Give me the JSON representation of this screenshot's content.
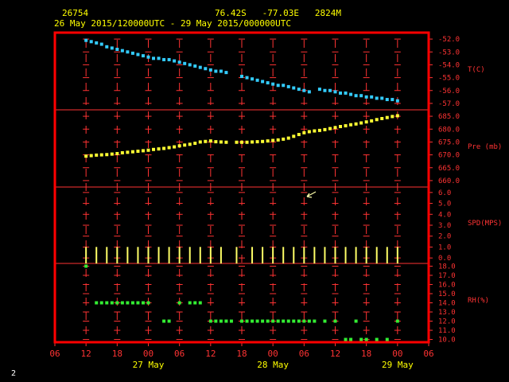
{
  "header": {
    "station": "26754",
    "location": "76.42S   -77.03E   2824M",
    "date_range": "26 May 2015/120000UTC - 29 May 2015/000000UTC"
  },
  "corner_label": "2",
  "chart_data": [
    {
      "type": "scatter",
      "title": "",
      "ylabel": "T(C)",
      "ylim": [
        -57.5,
        -51.5
      ],
      "yticks": [
        -52.0,
        -53.0,
        -54.0,
        -55.0,
        -56.0,
        -57.0
      ],
      "color": "#33ccff",
      "x_hours": [
        12,
        13,
        14,
        15,
        16,
        17,
        18,
        19,
        20,
        21,
        22,
        23,
        24,
        25,
        26,
        27,
        28,
        29,
        30,
        31,
        32,
        33,
        34,
        35,
        36,
        37,
        38,
        39,
        42,
        43,
        44,
        45,
        46,
        47,
        48,
        49,
        50,
        51,
        52,
        53,
        54,
        55,
        57,
        58,
        59,
        60,
        61,
        62,
        63,
        64,
        65,
        66,
        67,
        68,
        69,
        70,
        71,
        72
      ],
      "values": [
        -52.1,
        -52.2,
        -52.3,
        -52.4,
        -52.6,
        -52.7,
        -52.8,
        -52.9,
        -53.0,
        -53.1,
        -53.2,
        -53.3,
        -53.4,
        -53.5,
        -53.5,
        -53.6,
        -53.6,
        -53.7,
        -53.8,
        -53.9,
        -54.0,
        -54.1,
        -54.2,
        -54.3,
        -54.4,
        -54.5,
        -54.5,
        -54.6,
        -54.9,
        -55.0,
        -55.1,
        -55.2,
        -55.3,
        -55.4,
        -55.5,
        -55.6,
        -55.6,
        -55.7,
        -55.8,
        -55.9,
        -56.0,
        -56.1,
        -55.9,
        -56.0,
        -56.0,
        -56.1,
        -56.2,
        -56.2,
        -56.3,
        -56.4,
        -56.4,
        -56.5,
        -56.5,
        -56.6,
        -56.6,
        -56.7,
        -56.7,
        -56.8
      ]
    },
    {
      "type": "scatter",
      "ylabel": "Pre (mb)",
      "ylim": [
        657.5,
        687.5
      ],
      "yticks": [
        685.0,
        680.0,
        675.0,
        670.0,
        665.0,
        660.0
      ],
      "color": "#ffff33",
      "x_hours": [
        12,
        13,
        14,
        15,
        16,
        17,
        18,
        19,
        20,
        21,
        22,
        23,
        24,
        25,
        26,
        27,
        28,
        29,
        30,
        31,
        32,
        33,
        34,
        35,
        36,
        37,
        38,
        39,
        41,
        42,
        43,
        44,
        45,
        46,
        47,
        48,
        49,
        50,
        51,
        52,
        53,
        54,
        55,
        56,
        57,
        58,
        59,
        60,
        61,
        62,
        63,
        64,
        65,
        66,
        67,
        68,
        69,
        70,
        71,
        72
      ],
      "values": [
        669.5,
        669.7,
        669.9,
        670.0,
        670.1,
        670.3,
        670.5,
        670.8,
        671.0,
        671.2,
        671.4,
        671.6,
        671.8,
        672.1,
        672.3,
        672.5,
        672.8,
        673.1,
        673.5,
        673.8,
        674.1,
        674.5,
        675.0,
        675.2,
        675.4,
        675.1,
        675.0,
        674.9,
        674.9,
        674.9,
        674.9,
        675.0,
        675.1,
        675.2,
        675.4,
        675.6,
        675.8,
        676.1,
        676.5,
        677.2,
        677.9,
        678.6,
        679.0,
        679.3,
        679.5,
        679.8,
        680.2,
        680.6,
        681.0,
        681.3,
        681.7,
        682.0,
        682.4,
        682.8,
        683.2,
        683.7,
        684.1,
        684.5,
        684.9,
        685.2
      ]
    },
    {
      "type": "bar",
      "ylabel": "SPD(MPS)",
      "ylim": [
        -0.5,
        6.5
      ],
      "yticks": [
        6.0,
        5.0,
        4.0,
        3.0,
        2.0,
        1.0,
        0.0
      ],
      "color": "#ffff66",
      "x_hours": [
        12,
        14,
        16,
        18,
        20,
        22,
        24,
        26,
        28,
        30,
        32,
        34,
        36,
        38,
        41,
        44,
        46,
        48,
        50,
        52,
        54,
        56,
        58,
        60,
        62,
        64,
        66,
        68,
        70,
        72
      ],
      "values": [
        0.5,
        0.5,
        0.5,
        0.5,
        0.5,
        0.5,
        0.5,
        0.5,
        0.5,
        0.5,
        0.5,
        0.5,
        0.5,
        0.5,
        0.5,
        0.5,
        0.5,
        0.5,
        0.5,
        0.5,
        0.5,
        0.5,
        0.5,
        0.5,
        0.5,
        0.5,
        0.5,
        0.5,
        0.5,
        0.5
      ]
    },
    {
      "type": "scatter",
      "ylabel": "RH(%)",
      "ylim": [
        9.7,
        18.3
      ],
      "yticks": [
        18.0,
        17.0,
        16.0,
        15.0,
        14.0,
        13.0,
        12.0,
        11.0,
        10.0
      ],
      "color": "#33ee33",
      "x_hours": [
        12,
        14,
        15,
        16,
        17,
        18,
        19,
        20,
        21,
        22,
        23,
        24,
        27,
        28,
        30,
        32,
        33,
        34,
        36,
        37,
        38,
        39,
        40,
        42,
        43,
        44,
        45,
        46,
        47,
        48,
        49,
        50,
        51,
        52,
        53,
        54,
        55,
        56,
        58,
        60,
        62,
        63,
        64,
        65,
        66,
        68,
        70,
        72
      ],
      "values": [
        18.0,
        14.0,
        14.0,
        14.0,
        14.0,
        14.0,
        14.0,
        14.0,
        14.0,
        14.0,
        14.0,
        14.0,
        12.0,
        12.0,
        14.0,
        14.0,
        14.0,
        14.0,
        12.0,
        12.0,
        12.0,
        12.0,
        12.0,
        12.0,
        12.0,
        12.0,
        12.0,
        12.0,
        12.0,
        12.0,
        12.0,
        12.0,
        12.0,
        12.0,
        12.0,
        12.0,
        12.0,
        12.0,
        12.0,
        12.0,
        10.0,
        10.0,
        12.0,
        10.0,
        10.0,
        10.0,
        10.0,
        12.0
      ]
    }
  ],
  "x_axis": {
    "tick_labels": [
      "06",
      "12",
      "18",
      "00",
      "06",
      "12",
      "18",
      "00",
      "06",
      "12",
      "18",
      "00",
      "06"
    ],
    "day_labels": [
      "27 May",
      "28 May",
      "29 May"
    ],
    "day_label_hours": [
      24,
      48,
      72
    ],
    "range_hours": [
      6,
      78
    ]
  },
  "colors": {
    "frame": "#ff0000",
    "grid": "#ff3333",
    "axis_text": "#ff3333",
    "header": "#ffff00",
    "cursor": "#ffffaa"
  }
}
